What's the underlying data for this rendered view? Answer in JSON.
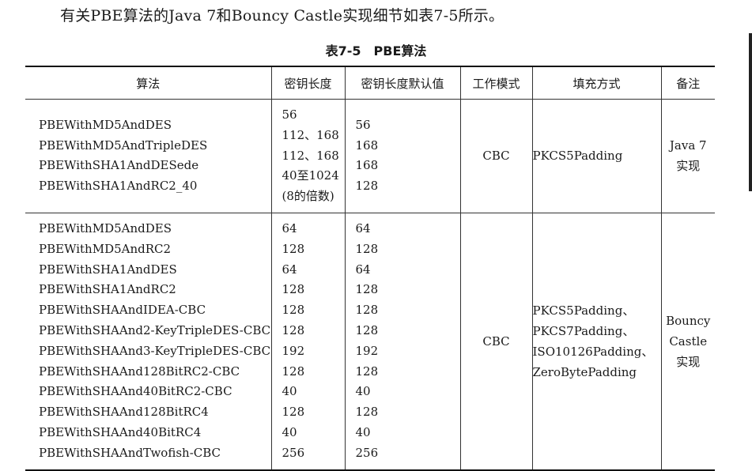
{
  "intro_text": "有关PBE算法的Java 7和Bouncy Castle实现细节如表7-5所示。",
  "caption": "表7-5　PBE算法",
  "headers": [
    "算法",
    "密钥长度",
    "密钥长度默认值",
    "工作模式",
    "填充方式",
    "备注"
  ],
  "groups": [
    {
      "algorithms": [
        "PBEWithMD5AndDES",
        "PBEWithMD5AndTripleDES",
        "PBEWithSHA1AndDESede",
        "PBEWithSHA1AndRC2_40"
      ],
      "key_lengths": [
        "56",
        "112、168",
        "112、168",
        "40至1024",
        "(8的倍数)"
      ],
      "defaults": [
        "56",
        "168",
        "168",
        "128"
      ],
      "mode": "CBC",
      "padding": [
        "PKCS5Padding"
      ],
      "note": [
        "Java 7",
        "实现"
      ]
    },
    {
      "algorithms": [
        "PBEWithMD5AndDES",
        "PBEWithMD5AndRC2",
        "PBEWithSHA1AndDES",
        "PBEWithSHA1AndRC2",
        "PBEWithSHAAndIDEA-CBC",
        "PBEWithSHAAnd2-KeyTripleDES-CBC",
        "PBEWithSHAAnd3-KeyTripleDES-CBC",
        "PBEWithSHAAnd128BitRC2-CBC",
        "PBEWithSHAAnd40BitRC2-CBC",
        "PBEWithSHAAnd128BitRC4",
        "PBEWithSHAAnd40BitRC4",
        "PBEWithSHAAndTwofish-CBC"
      ],
      "key_lengths": [
        "64",
        "128",
        "64",
        "128",
        "128",
        "128",
        "192",
        "128",
        "40",
        "128",
        "40",
        "256"
      ],
      "defaults": [
        "64",
        "128",
        "64",
        "128",
        "128",
        "128",
        "192",
        "128",
        "40",
        "128",
        "40",
        "256"
      ],
      "mode": "CBC",
      "padding": [
        "PKCS5Padding、",
        "PKCS7Padding、",
        "ISO10126Padding、",
        "ZeroBytePadding"
      ],
      "note": [
        "Bouncy",
        "Castle",
        "实现"
      ]
    }
  ]
}
